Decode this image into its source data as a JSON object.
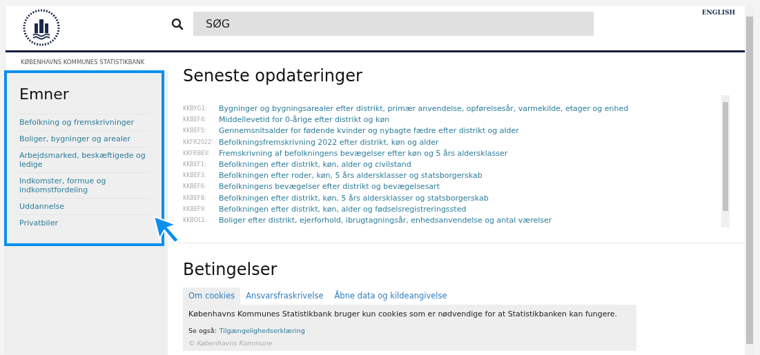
{
  "header": {
    "search_button": "SØG",
    "language_link": "ENGLISH"
  },
  "breadcrumb": "KØBENHAVNS KOMMUNES STATISTIKBANK",
  "sidebar": {
    "title": "Emner",
    "items": [
      "Befolkning og fremskrivninger",
      "Boliger, bygninger og arealer",
      "Arbejdsmarked, beskæftigede og ledige",
      "Indkomster, formue og indkomstfordeling",
      "Uddannelse",
      "Privatbiler"
    ]
  },
  "updates": {
    "title": "Seneste opdateringer",
    "items": [
      {
        "code": "KKBYG1:",
        "title": "Bygninger og bygningsarealer efter distrikt, primær anvendelse, opførelsesår, varmekilde, etager og enhed"
      },
      {
        "code": "KKBEF4:",
        "title": "Middellevetid for 0-årige efter distrikt og køn"
      },
      {
        "code": "KKBEF5:",
        "title": "Gennemsnitsalder for fødende kvinder og nybagte fædre efter distrikt og alder"
      },
      {
        "code": "KKFR2022:",
        "title": "Befolkningsfremskrivning 2022 efter distrikt, køn og alder"
      },
      {
        "code": "KKFRBEV:",
        "title": "Fremskrivning af befolkningens bevægelser efter køn og 5 års aldersklasser"
      },
      {
        "code": "KKBEF1:",
        "title": "Befolkningen efter distrikt, køn, alder og civilstand"
      },
      {
        "code": "KKBEF3:",
        "title": "Befolkningen efter roder, køn, 5 års aldersklasser og statsborgerskab"
      },
      {
        "code": "KKBEF6:",
        "title": "Befolkningens bevægelser efter distrikt og bevægelsesart"
      },
      {
        "code": "KKBEF8:",
        "title": "Befolkningen efter distrikt, køn, 5 års aldersklasser og statsborgerskab"
      },
      {
        "code": "KKBEF9:",
        "title": "Befolkningen efter distrikt, køn, alder og fødselsregistreringssted"
      },
      {
        "code": "KKBOL1:",
        "title": "Boliger efter distrikt, ejerforhold, ibrugtagningsår, enhedsanvendelse og antal værelser"
      }
    ]
  },
  "conditions": {
    "title": "Betingelser",
    "tabs": [
      {
        "label": "Om cookies",
        "selected": true
      },
      {
        "label": "Ansvarsfraskrivelse",
        "selected": false
      },
      {
        "label": "Åbne data og kildeangivelse",
        "selected": false
      }
    ],
    "text": "Københavns Kommunes Statistikbank bruger kun cookies som er nødvendige for at Statistikbanken kan fungere.",
    "see_also_label": "Se også:",
    "see_also_link": "Tilgængelighedserklæring",
    "footer": "© Københavns Kommune"
  }
}
